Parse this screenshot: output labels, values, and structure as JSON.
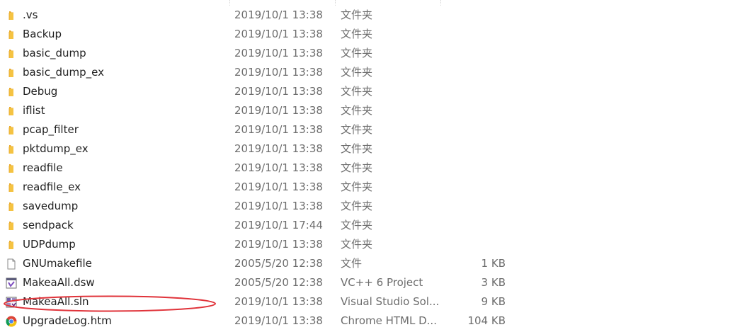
{
  "colors": {
    "folder": "#f5c342",
    "folder_dark": "#e8a92a",
    "meta_text": "#6d6d6d",
    "annotation_ellipse": "#e0333a"
  },
  "files": [
    {
      "name": ".vs",
      "date": "2019/10/1 13:38",
      "type": "文件夹",
      "size": "",
      "icon": "folder-icon"
    },
    {
      "name": "Backup",
      "date": "2019/10/1 13:38",
      "type": "文件夹",
      "size": "",
      "icon": "folder-icon"
    },
    {
      "name": "basic_dump",
      "date": "2019/10/1 13:38",
      "type": "文件夹",
      "size": "",
      "icon": "folder-icon"
    },
    {
      "name": "basic_dump_ex",
      "date": "2019/10/1 13:38",
      "type": "文件夹",
      "size": "",
      "icon": "folder-icon"
    },
    {
      "name": "Debug",
      "date": "2019/10/1 13:38",
      "type": "文件夹",
      "size": "",
      "icon": "folder-icon"
    },
    {
      "name": "iflist",
      "date": "2019/10/1 13:38",
      "type": "文件夹",
      "size": "",
      "icon": "folder-icon"
    },
    {
      "name": "pcap_filter",
      "date": "2019/10/1 13:38",
      "type": "文件夹",
      "size": "",
      "icon": "folder-icon"
    },
    {
      "name": "pktdump_ex",
      "date": "2019/10/1 13:38",
      "type": "文件夹",
      "size": "",
      "icon": "folder-icon"
    },
    {
      "name": "readfile",
      "date": "2019/10/1 13:38",
      "type": "文件夹",
      "size": "",
      "icon": "folder-icon"
    },
    {
      "name": "readfile_ex",
      "date": "2019/10/1 13:38",
      "type": "文件夹",
      "size": "",
      "icon": "folder-icon"
    },
    {
      "name": "savedump",
      "date": "2019/10/1 13:38",
      "type": "文件夹",
      "size": "",
      "icon": "folder-icon"
    },
    {
      "name": "sendpack",
      "date": "2019/10/1 17:44",
      "type": "文件夹",
      "size": "",
      "icon": "folder-icon"
    },
    {
      "name": "UDPdump",
      "date": "2019/10/1 13:38",
      "type": "文件夹",
      "size": "",
      "icon": "folder-icon"
    },
    {
      "name": "GNUmakefile",
      "date": "2005/5/20 12:38",
      "type": "文件",
      "size": "1 KB",
      "icon": "blank-file-icon"
    },
    {
      "name": "MakeaAll.dsw",
      "date": "2005/5/20 12:38",
      "type": "VC++ 6 Project",
      "size": "3 KB",
      "icon": "visual-studio-project-icon"
    },
    {
      "name": "MakeaAll.sln",
      "date": "2019/10/1 13:38",
      "type": "Visual Studio Sol...",
      "size": "9 KB",
      "icon": "visual-studio-solution-icon"
    },
    {
      "name": "UpgradeLog.htm",
      "date": "2019/10/1 13:38",
      "type": "Chrome HTML D...",
      "size": "104 KB",
      "icon": "chrome-icon"
    }
  ]
}
